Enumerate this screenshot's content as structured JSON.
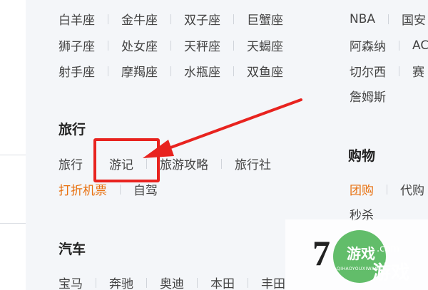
{
  "zodiac": {
    "row1": [
      "白羊座",
      "金牛座",
      "双子座",
      "巨蟹座"
    ],
    "row2": [
      "狮子座",
      "处女座",
      "天秤座",
      "天蝎座"
    ],
    "row3": [
      "射手座",
      "摩羯座",
      "水瓶座",
      "双鱼座"
    ]
  },
  "sports": {
    "row1": [
      "NBA",
      "国安"
    ],
    "row2": [
      "阿森纳",
      "AC"
    ],
    "row3": [
      "切尔西",
      "赛"
    ],
    "row4": [
      "詹姆斯"
    ]
  },
  "travel": {
    "title": "旅行",
    "row1": [
      "旅行",
      "游记",
      "旅游攻略",
      "旅行社"
    ],
    "row2": [
      "打折机票",
      "自驾"
    ]
  },
  "shopping": {
    "title": "购物",
    "row1": [
      "团购",
      "代购"
    ],
    "row2": [
      "秒杀"
    ]
  },
  "car": {
    "title": "汽车",
    "row1": [
      "宝马",
      "奔驰",
      "奥迪",
      "本田",
      "丰田"
    ]
  },
  "watermark": {
    "number": "7",
    "brand_a": "游戏",
    "brand_b": "游戏",
    "tagline": "QIHAOYOUXIWANG",
    "domain": ".com"
  },
  "colors": {
    "accent_orange": "#e8700f",
    "annotation_red": "#e8231f",
    "background": "#f4f6f9"
  }
}
